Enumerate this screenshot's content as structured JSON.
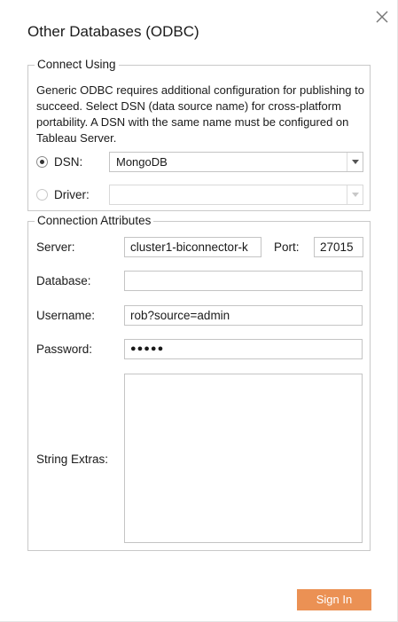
{
  "dialog": {
    "title": "Other Databases (ODBC)",
    "close_icon": "close-icon"
  },
  "connect_using": {
    "legend": "Connect Using",
    "description": "Generic ODBC requires additional configuration for publishing to succeed. Select DSN (data source name) for cross-platform portability. A DSN with the same name must be configured on Tableau Server.",
    "dsn": {
      "label": "DSN:",
      "selected": true,
      "value": "MongoDB"
    },
    "driver": {
      "label": "Driver:",
      "selected": false,
      "value": ""
    }
  },
  "connection_attributes": {
    "legend": "Connection Attributes",
    "server": {
      "label": "Server:",
      "value": "cluster1-biconnector-k"
    },
    "port": {
      "label": "Port:",
      "value": "27015"
    },
    "database": {
      "label": "Database:",
      "value": ""
    },
    "username": {
      "label": "Username:",
      "value": "rob?source=admin"
    },
    "password": {
      "label": "Password:",
      "value": "●●●●●"
    },
    "string_extras": {
      "label": "String Extras:",
      "value": ""
    }
  },
  "actions": {
    "sign_in_label": "Sign In"
  },
  "colors": {
    "accent": "#eb9154",
    "border": "#c4c4c4"
  }
}
